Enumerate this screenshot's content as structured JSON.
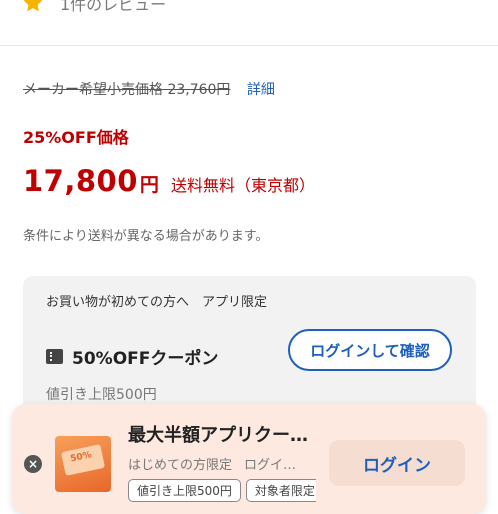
{
  "review": {
    "star_icon": "star-icon",
    "text": "1件のレビュー",
    "star_color": "#f5b400"
  },
  "pricing": {
    "list_price_label": "メーカー希望小売価格 23,760円",
    "detail_link": "詳細",
    "discount_label": "25%OFF価格",
    "price_number": "17,800",
    "price_unit": "円",
    "shipping": "送料無料（東京都）",
    "condition_note": "条件により送料が異なる場合があります。",
    "accent_color": "#bf0000"
  },
  "coupon": {
    "intro": "お買い物が初めての方へ　アプリ限定",
    "icon": "ticket-icon",
    "title": "50%OFFクーポン",
    "button_label": "ログインして確認",
    "limit": "値引き上限500円"
  },
  "banner": {
    "close_icon": "close-icon",
    "title": "最大半額アプリクー…",
    "subtitle_1": "はじめての方限定",
    "subtitle_2": "ログイ…",
    "tags": [
      "値引き上限500円",
      "対象者限定"
    ],
    "login_label": "ログイン",
    "link_color": "#1d5fbf"
  }
}
